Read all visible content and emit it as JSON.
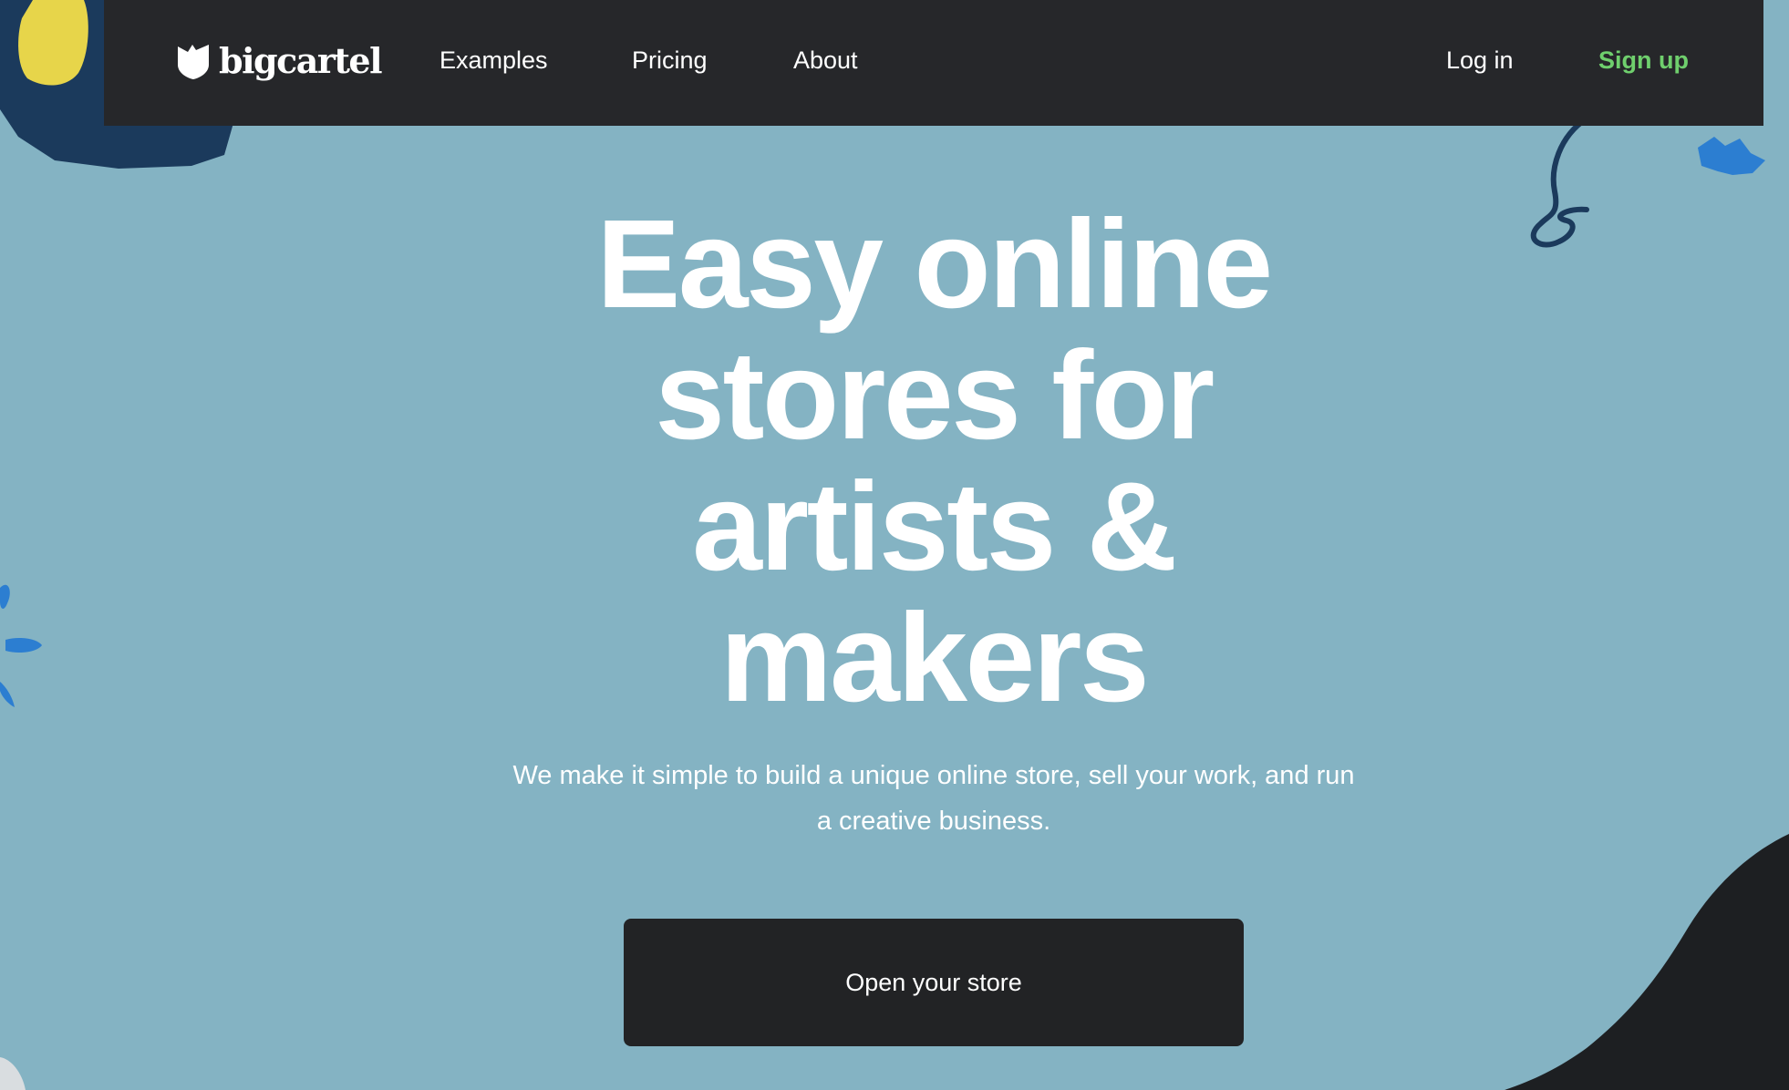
{
  "brand": {
    "name": "bigcartel",
    "icon": "bigcartel-shield-icon"
  },
  "nav": {
    "links": [
      {
        "label": "Examples"
      },
      {
        "label": "Pricing"
      },
      {
        "label": "About"
      }
    ],
    "login_label": "Log in",
    "signup_label": "Sign up"
  },
  "hero": {
    "title_lines": [
      "Easy online",
      "stores for",
      "artists &",
      "makers"
    ],
    "subtitle": "We make it simple to build a unique online store, sell your work, and run a creative business.",
    "cta_label": "Open your store"
  },
  "colors": {
    "background": "#84b3c3",
    "nav_background": "#26272a",
    "signup_accent": "#6fcf6d",
    "cta_background": "#222325",
    "text": "#ffffff"
  }
}
